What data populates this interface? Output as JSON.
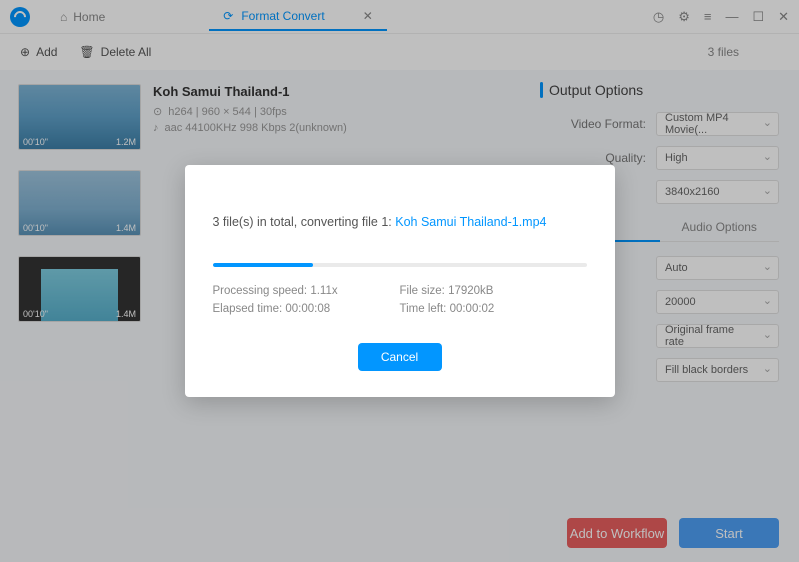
{
  "titlebar": {
    "home_label": "Home",
    "active_tab_label": "Format Convert"
  },
  "toolbar": {
    "add_label": "Add",
    "delete_all_label": "Delete All",
    "file_count": "3 files"
  },
  "files": [
    {
      "title": "Koh Samui Thailand-1",
      "duration": "00'10\"",
      "size": "1.2M",
      "video_line": "h264   |   960  ×  544   |   30fps",
      "audio_line": "aac    44100KHz    998 Kbps    2(unknown)"
    },
    {
      "title": "",
      "duration": "00'10\"",
      "size": "1.4M"
    },
    {
      "title": "",
      "duration": "00'10\"",
      "size": "1.4M"
    }
  ],
  "output": {
    "header": "Output Options",
    "video_format_label": "Video Format:",
    "video_format_value": "Custom MP4 Movie(...",
    "quality_label": "Quality:",
    "quality_value": "High",
    "resolution_value": "3840x2160",
    "audio_options_tab": "Audio Options",
    "v1": "Auto",
    "v2": "20000",
    "v3": "Original frame rate",
    "v4": "Fill black borders"
  },
  "actions": {
    "add_to_workflow": "Add to Workflow",
    "start": "Start"
  },
  "modal": {
    "prefix": "3 file(s) in total, converting file 1: ",
    "filename": "Koh Samui Thailand-1.mp4",
    "progress_pct": 27,
    "speed_label": "Processing speed: ",
    "speed_value": "1.11x",
    "filesize_label": "File size: ",
    "filesize_value": "17920kB",
    "elapsed_label": "Elapsed time: ",
    "elapsed_value": "00:00:08",
    "timeleft_label": "Time left: ",
    "timeleft_value": "00:00:02",
    "cancel": "Cancel"
  }
}
